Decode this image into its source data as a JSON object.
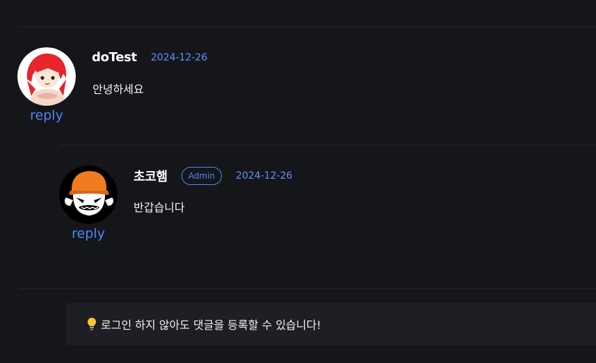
{
  "comments": [
    {
      "author": "doTest",
      "date": "2024-12-26",
      "text": "안녕하세요",
      "reply_label": "reply",
      "avatar": "red-hair-girl-avatar"
    },
    {
      "author": "초코햄",
      "badge": "Admin",
      "date": "2024-12-26",
      "text": "반갑습니다",
      "reply_label": "reply",
      "avatar": "monkey-orange-cap-avatar"
    }
  ],
  "notice": {
    "icon": "lightbulb-icon",
    "text": "로그인 하지 않아도 댓글을 등록할 수 있습니다!"
  },
  "colors": {
    "background": "#15161a",
    "accent": "#4f86f7",
    "notice_background": "#1e1f24"
  }
}
